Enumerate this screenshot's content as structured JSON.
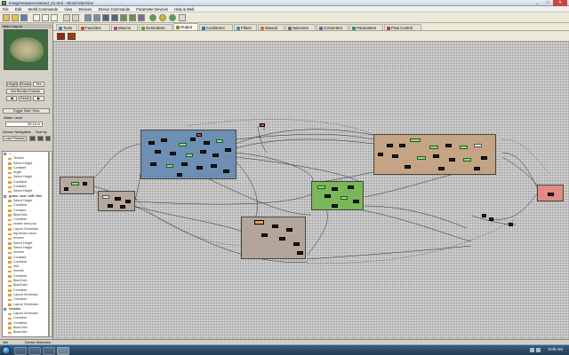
{
  "window": {
    "title": "ImageSequenceIsland_01.tmd - World Machine",
    "controls": [
      "_",
      "□",
      "✕"
    ]
  },
  "menu": [
    "File",
    "Edit",
    "World Commands",
    "View",
    "Devices",
    "Device Commands",
    "Parameter Devices",
    "Help & Web"
  ],
  "left_panel": {
    "header": "Main Layout",
    "view_buttons": [
      "Height",
      "Shade",
      "Tex"
    ],
    "set_render_extents": "Set Render Extents",
    "small_buttons": [
      "◀",
      "Reset",
      "▶"
    ],
    "toggle_view": "Toggle Main View",
    "water_level_label": "Water Level",
    "water_level_value": "55.18 m",
    "device_navigation_label": "Device Navigation",
    "sort_by_label": "Sort by",
    "lock_preview_button": "Lock Preview",
    "tree_items": [
      {
        "label": "...",
        "group": true
      },
      {
        "label": "Terrace",
        "group": false
      },
      {
        "label": "Select Height",
        "group": false
      },
      {
        "label": "Constant",
        "group": false
      },
      {
        "label": "Angle",
        "group": false
      },
      {
        "label": "Select Height",
        "group": false
      },
      {
        "label": "Combiner",
        "group": false
      },
      {
        "label": "Constant",
        "group": false
      },
      {
        "label": "Select Height",
        "group": false
      },
      {
        "label": "grass / sea / cliff / fine",
        "group": true
      },
      {
        "label": "Select Height",
        "group": false
      },
      {
        "label": "Combiner",
        "group": false
      },
      {
        "label": "Constant",
        "group": false
      },
      {
        "label": "Bias/Gain",
        "group": false
      },
      {
        "label": "Combiner",
        "group": false
      },
      {
        "label": "scatter area (via",
        "group": false
      },
      {
        "label": "Layout Generator",
        "group": false
      },
      {
        "label": "big terrain struct",
        "group": false
      },
      {
        "label": "erosion",
        "group": false
      },
      {
        "label": "Select Height",
        "group": false
      },
      {
        "label": "Select Height",
        "group": false
      },
      {
        "label": "Inverter",
        "group": false
      },
      {
        "label": "Constant",
        "group": false
      },
      {
        "label": "Combiner",
        "group": false
      },
      {
        "label": "mid",
        "group": false
      },
      {
        "label": "Inverter",
        "group": false
      },
      {
        "label": "Combiner",
        "group": false
      },
      {
        "label": "Bias/Gain",
        "group": false
      },
      {
        "label": "Bias/Gain",
        "group": false
      },
      {
        "label": "Combiner",
        "group": false
      },
      {
        "label": "Layout Generator",
        "group": false
      },
      {
        "label": "Combiner",
        "group": false
      },
      {
        "label": "Layout Generator",
        "group": false
      },
      {
        "label": "erosion",
        "group": true
      },
      {
        "label": "Layout Generator",
        "group": false
      },
      {
        "label": "Combiner",
        "group": false
      },
      {
        "label": "Combiner",
        "group": false
      },
      {
        "label": "Bias/Gain",
        "group": false
      },
      {
        "label": "Bias/Gain",
        "group": false
      }
    ]
  },
  "tabs": [
    {
      "label": "Tools",
      "color": "#4a7fb5"
    },
    {
      "label": "Favorites",
      "color": "#d04545"
    },
    {
      "label": "Macros",
      "color": "#b04a8a"
    },
    {
      "label": "Generators",
      "color": "#6a9a3a"
    },
    {
      "label": "Output",
      "color": "#9b7b3a",
      "active": true
    },
    {
      "label": "Combiners",
      "color": "#2e6fb0"
    },
    {
      "label": "Filters",
      "color": "#4f8a9a"
    },
    {
      "label": "Natural",
      "color": "#c07a30"
    },
    {
      "label": "Selectors",
      "color": "#6c6c6c"
    },
    {
      "label": "Converters",
      "color": "#7a5aa0"
    },
    {
      "label": "Parameters",
      "color": "#3a8a6a"
    },
    {
      "label": "Flow Control",
      "color": "#aa4444"
    }
  ],
  "canvas": {
    "groups": [
      {
        "id": "far-left",
        "color": "#b8a9a0"
      },
      {
        "id": "left",
        "color": "#b6a89c"
      },
      {
        "id": "blue",
        "color": "#6e8fb4"
      },
      {
        "id": "gray-mid",
        "color": "#b3a59a"
      },
      {
        "id": "green",
        "color": "#7bb65a"
      },
      {
        "id": "brown",
        "color": "#c4a484"
      },
      {
        "id": "red",
        "color": "#e28b84"
      }
    ]
  },
  "status": {
    "left": "Idle",
    "device": "Device Workview"
  },
  "taskbar": {
    "clock": "8:08 AM"
  }
}
